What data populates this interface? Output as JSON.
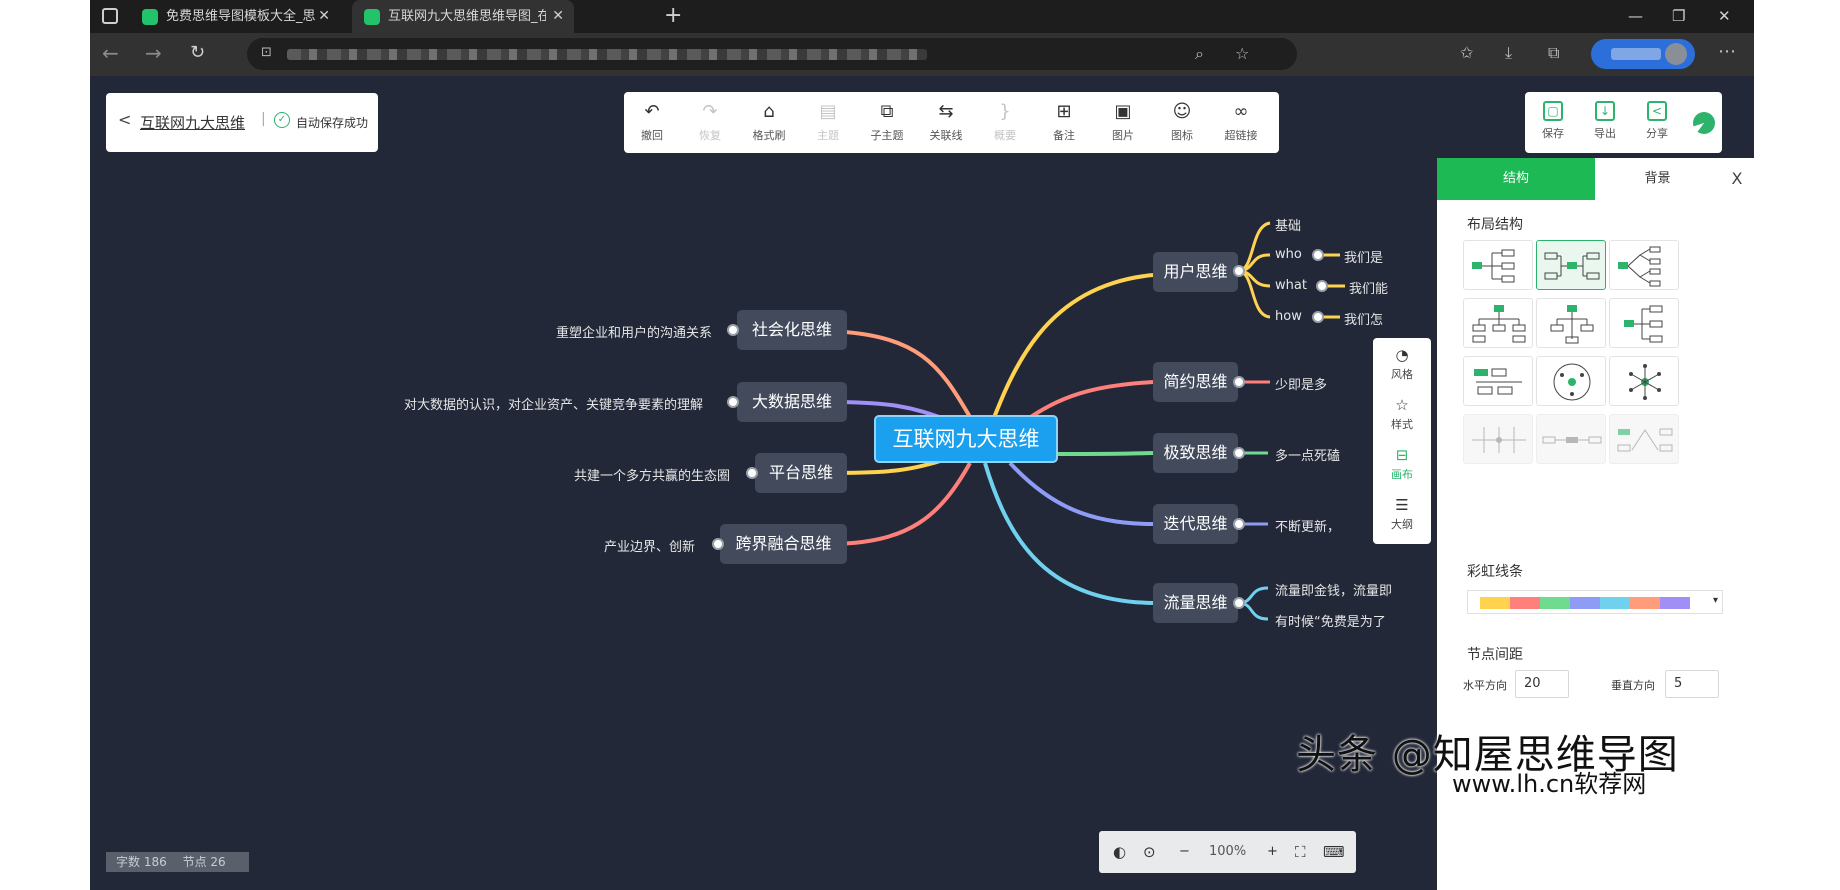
{
  "browser": {
    "tabs": [
      {
        "title": "免费思维导图模板大全_思维导图"
      },
      {
        "title": "互联网九大思维思维导图_在线思"
      }
    ],
    "new_tab": "+",
    "window_controls": {
      "minimize": "—",
      "maximize": "❐",
      "close": "✕"
    }
  },
  "header": {
    "back": "<",
    "doc_title": "互联网九大思维",
    "divider": "|",
    "save_status": "自动保存成功"
  },
  "toolbar": [
    {
      "label": "撤回",
      "icon": "↶",
      "enabled": true
    },
    {
      "label": "恢复",
      "icon": "↷",
      "enabled": false
    },
    {
      "label": "格式刷",
      "icon": "⌂",
      "enabled": true
    },
    {
      "label": "主题",
      "icon": "▤",
      "enabled": false
    },
    {
      "label": "子主题",
      "icon": "⧉",
      "enabled": true
    },
    {
      "label": "关联线",
      "icon": "⇆",
      "enabled": true
    },
    {
      "label": "概要",
      "icon": "}",
      "enabled": false
    },
    {
      "label": "备注",
      "icon": "⊞",
      "enabled": true
    },
    {
      "label": "图片",
      "icon": "▣",
      "enabled": true
    },
    {
      "label": "图标",
      "icon": "☺",
      "enabled": true
    },
    {
      "label": "超链接",
      "icon": "∞",
      "enabled": true
    }
  ],
  "right_actions": [
    {
      "label": "保存",
      "icon": "▢"
    },
    {
      "label": "导出",
      "icon": "↓"
    },
    {
      "label": "分享",
      "icon": "<"
    }
  ],
  "mindmap": {
    "root": "互联网九大思维",
    "right_nodes": [
      {
        "label": "用户思维",
        "color": "#ffd34f"
      },
      {
        "label": "简约思维",
        "color": "#ff7f7a"
      },
      {
        "label": "极致思维",
        "color": "#6fdb8f"
      },
      {
        "label": "迭代思维",
        "color": "#8f9cf5"
      },
      {
        "label": "流量思维",
        "color": "#6fd1ee"
      }
    ],
    "left_nodes": [
      {
        "label": "社会化思维",
        "color": "#ff9d7a"
      },
      {
        "label": "大数据思维",
        "color": "#a18ff5"
      },
      {
        "label": "平台思维",
        "color": "#ffd34f"
      },
      {
        "label": "跨界融合思维",
        "color": "#ff7f7a"
      }
    ],
    "user_children": [
      "基础",
      "who",
      "what",
      "how"
    ],
    "user_leaf_texts": [
      "我们是",
      "我们能",
      "我们怎"
    ],
    "simple_leaf": "少即是多",
    "extreme_leaf": "多一点死磕",
    "iter_leaf": "不断更新，",
    "traffic_leaves": [
      "流量即金钱，流量即",
      "有时候“免费是为了"
    ],
    "left_leaves": [
      "重塑企业和用户的沟通关系",
      "对大数据的认识，对企业资产、关键竞争要素的理解",
      "共建一个多方共赢的生态圈",
      "产业边界、创新"
    ]
  },
  "side_menu": [
    {
      "label": "风格",
      "icon": "◔",
      "active": false
    },
    {
      "label": "样式",
      "icon": "☆",
      "active": false
    },
    {
      "label": "画布",
      "icon": "⊟",
      "active": true
    },
    {
      "label": "大纲",
      "icon": "☰",
      "active": false
    }
  ],
  "panel": {
    "tabs": [
      "结构",
      "背景"
    ],
    "close": "X",
    "layout_title": "布局结构",
    "rainbow_title": "彩虹线条",
    "rainbow_colors": [
      "#ffd34f",
      "#ff7f7a",
      "#6fdb8f",
      "#8f9cf5",
      "#6fd1ee",
      "#ff9d7a",
      "#a18ff5"
    ],
    "rainbow_dropdown": "▾",
    "spacing_title": "节点间距",
    "h_label": "水平方向",
    "h_value": "20",
    "v_label": "垂直方向",
    "v_value": "5"
  },
  "status": {
    "words": "字数 186",
    "nodes": "节点 26"
  },
  "zoom": {
    "minus": "−",
    "value": "100%",
    "plus": "+"
  },
  "watermark": {
    "main": "头条 @知屋思维导图",
    "site": "www.lh.cn软荐网"
  },
  "colors": {
    "canvas": "#222838",
    "node": "#424a5c",
    "root": "#1aa0ef",
    "accent": "#1db954"
  }
}
